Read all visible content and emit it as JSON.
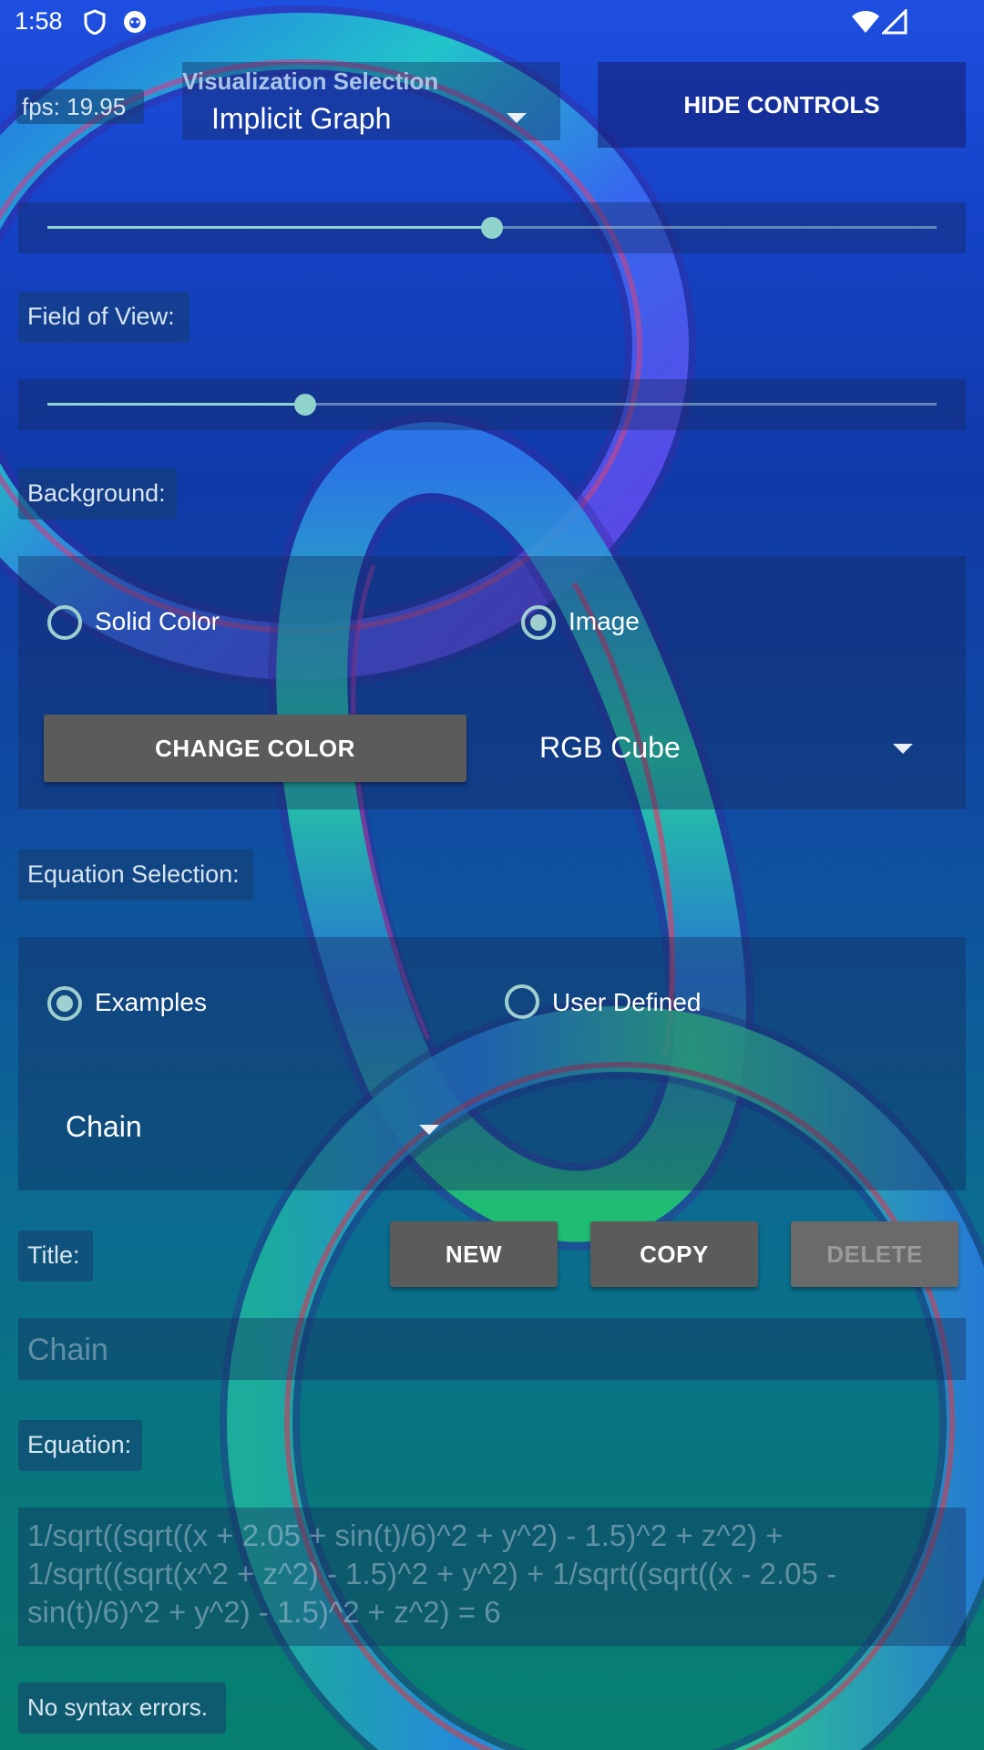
{
  "status_bar": {
    "time": "1:58",
    "icons": [
      "shield-icon",
      "app-badge-icon",
      "wifi-icon",
      "cell-signal-icon"
    ]
  },
  "fps": "fps: 19.95",
  "visualization": {
    "label": "Visualization Selection",
    "selected": "Implicit Graph"
  },
  "hide_controls_label": "HIDE CONTROLS",
  "sliders": {
    "top_level": 0.5,
    "fov_level": 0.29
  },
  "field_of_view_label": "Field of View:",
  "background": {
    "label": "Background:",
    "solid_color_label": "Solid Color",
    "image_label": "Image",
    "selected": "Image",
    "change_color_label": "CHANGE COLOR",
    "image_selected": "RGB Cube"
  },
  "equation_selection": {
    "label": "Equation Selection:",
    "examples_label": "Examples",
    "user_defined_label": "User Defined",
    "selected": "Examples",
    "example_selected": "Chain"
  },
  "title": {
    "label": "Title:",
    "new_label": "NEW",
    "copy_label": "COPY",
    "delete_label": "DELETE",
    "value": "Chain"
  },
  "equation": {
    "label": "Equation:",
    "value": "1/sqrt((sqrt((x + 2.05 + sin(t)/6)^2 + y^2) - 1.5)^2 + z^2) + 1/sqrt((sqrt(x^2 + z^2) - 1.5)^2 + y^2) + 1/sqrt((sqrt((x - 2.05 - sin(t)/6)^2 + y^2) - 1.5)^2 + z^2) = 6"
  },
  "syntax_status": "No syntax errors."
}
